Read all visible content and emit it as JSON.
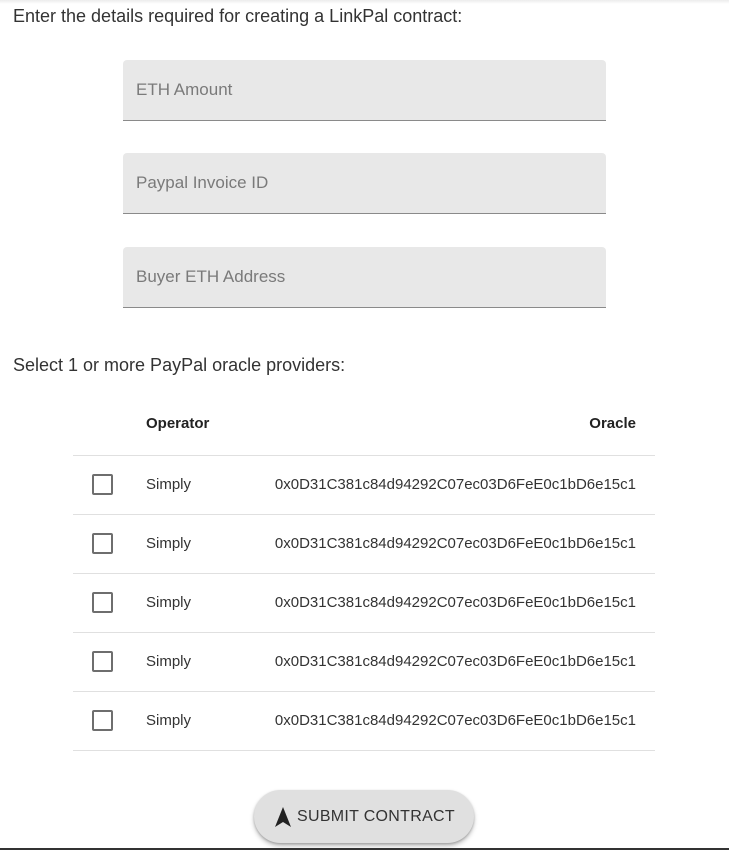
{
  "intro_text": "Enter the details required for creating a LinkPal contract:",
  "fields": {
    "eth_amount": {
      "placeholder": "ETH Amount",
      "value": ""
    },
    "invoice_id": {
      "placeholder": "Paypal Invoice ID",
      "value": ""
    },
    "buyer_address": {
      "placeholder": "Buyer ETH Address",
      "value": ""
    }
  },
  "select_label": "Select 1 or more PayPal oracle providers:",
  "table": {
    "headers": {
      "operator": "Operator",
      "oracle": "Oracle"
    },
    "rows": [
      {
        "checked": false,
        "operator": "Simply",
        "oracle": "0x0D31C381c84d94292C07ec03D6FeE0c1bD6e15c1"
      },
      {
        "checked": false,
        "operator": "Simply",
        "oracle": "0x0D31C381c84d94292C07ec03D6FeE0c1bD6e15c1"
      },
      {
        "checked": false,
        "operator": "Simply",
        "oracle": "0x0D31C381c84d94292C07ec03D6FeE0c1bD6e15c1"
      },
      {
        "checked": false,
        "operator": "Simply",
        "oracle": "0x0D31C381c84d94292C07ec03D6FeE0c1bD6e15c1"
      },
      {
        "checked": false,
        "operator": "Simply",
        "oracle": "0x0D31C381c84d94292C07ec03D6FeE0c1bD6e15c1"
      }
    ]
  },
  "submit": {
    "label": "SUBMIT CONTRACT",
    "icon": "navigation-arrow-icon"
  }
}
